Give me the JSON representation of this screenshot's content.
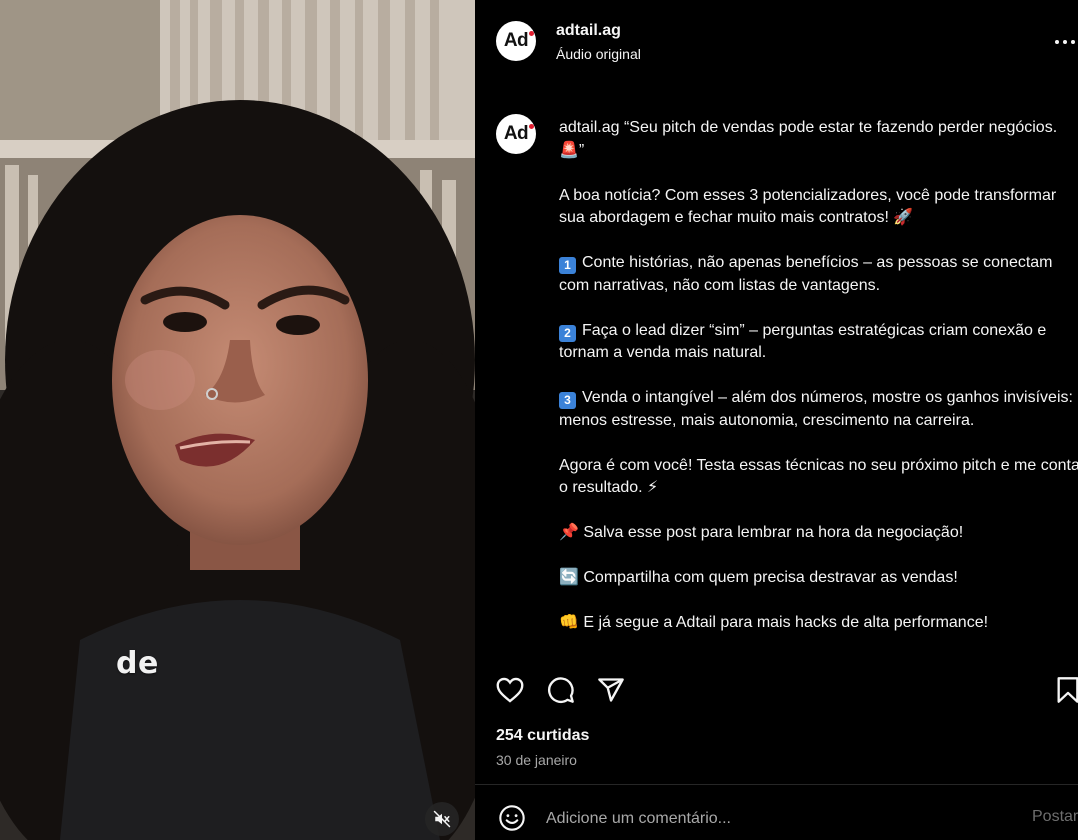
{
  "video": {
    "caption_word": "de",
    "mute_icon": "speaker-muted-icon"
  },
  "post": {
    "username": "adtail.ag",
    "audio_label": "Áudio original",
    "avatar_text": "Ad",
    "avatar_dot_color": "#e11d2f"
  },
  "caption": {
    "username": "adtail.ag",
    "line1": "“Seu pitch de vendas pode estar te fazendo perder negócios. 🚨”",
    "p2": "A boa notícia? Com esses 3 potencializadores, você pode transformar sua abordagem e fechar muito mais contratos! 🚀",
    "p3_num": "1",
    "p3": "Conte histórias, não apenas benefícios – as pessoas se conectam com narrativas, não com listas de vantagens.",
    "p4_num": "2",
    "p4": "Faça o lead dizer “sim” – perguntas estratégicas criam conexão e tornam a venda mais natural.",
    "p5_num": "3",
    "p5": "Venda o intangível – além dos números, mostre os ganhos invisíveis: menos estresse, mais autonomia, crescimento na carreira.",
    "p6": "Agora é com você! Testa essas técnicas no seu próximo pitch e me conta o resultado. ⚡",
    "p7": "📌 Salva esse post para lembrar na hora da negociação!",
    "p8": "🔄 Compartilha com quem precisa destravar as vendas!",
    "p9": "👊 E já segue a Adtail para mais hacks de alta performance!"
  },
  "actions": {
    "icons": [
      "heart-icon",
      "comment-icon",
      "share-icon",
      "bookmark-icon"
    ]
  },
  "stats": {
    "likes": "254 curtidas",
    "date": "30 de janeiro"
  },
  "comment": {
    "placeholder": "Adicione um comentário...",
    "post_label": "Postar"
  }
}
